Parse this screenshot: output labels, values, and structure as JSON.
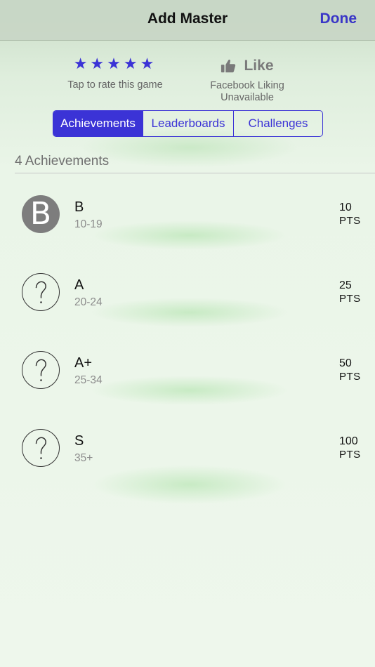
{
  "nav": {
    "title": "Add Master",
    "done_label": "Done"
  },
  "rating": {
    "stars": "★★★★★",
    "caption": "Tap to rate this game"
  },
  "like": {
    "icon": "thumbs-up-icon",
    "label": "Like",
    "caption_line1": "Facebook Liking",
    "caption_line2": "Unavailable"
  },
  "tabs": [
    {
      "label": "Achievements",
      "active": true
    },
    {
      "label": "Leaderboards",
      "active": false
    },
    {
      "label": "Challenges",
      "active": false
    }
  ],
  "achievements_header": "4 Achievements",
  "achievements": [
    {
      "badge": "B",
      "title": "B",
      "range": "10-19",
      "points": "10",
      "pts_label": "PTS"
    },
    {
      "badge": "?",
      "title": "A",
      "range": "20-24",
      "points": "25",
      "pts_label": "PTS"
    },
    {
      "badge": "?",
      "title": "A+",
      "range": "25-34",
      "points": "50",
      "pts_label": "PTS"
    },
    {
      "badge": "?",
      "title": "S",
      "range": "35+",
      "points": "100",
      "pts_label": "PTS"
    }
  ],
  "colors": {
    "accent": "#3b33d6",
    "done": "#3a36c7",
    "badge_unlocked": "#7d7d7d"
  }
}
